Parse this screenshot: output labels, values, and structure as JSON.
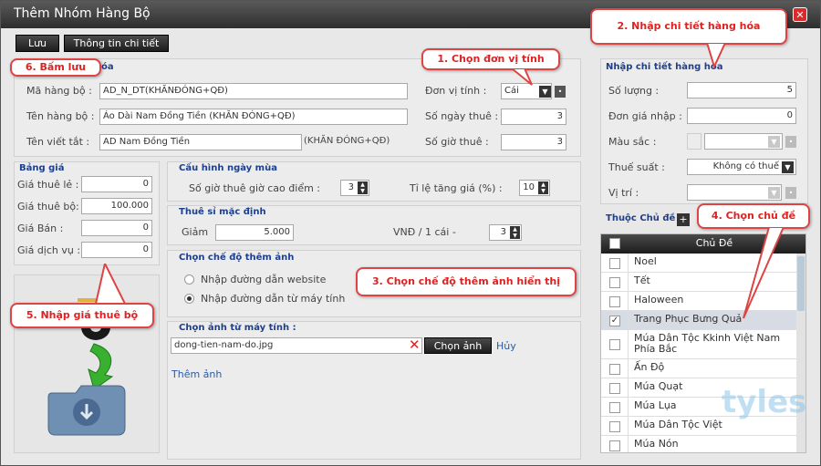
{
  "window": {
    "title": "Thêm Nhóm Hàng Bộ",
    "close": "✕"
  },
  "toolbar": {
    "save_label": "Lưu",
    "details_label": "Thông tin chi tiết"
  },
  "callouts": {
    "c1": "1. Chọn đơn vị tính",
    "c2": "2. Nhập chi tiết hàng hóa",
    "c3": "3. Chọn chế độ thêm ảnh hiển thị",
    "c4": "4. Chọn chủ đề",
    "c5": "5. Nhập giá thuê bộ",
    "c6": "6. Bấm lưu"
  },
  "info": {
    "title_tail": "óa",
    "code_label": "Mã hàng bộ :",
    "code_value": "AD_N_DT(KHĂNĐÓNG+QĐ)",
    "name_label": "Tên hàng bộ :",
    "name_value": "Áo Dài Nam Đồng Tiền (KHĂN ĐÓNG+QĐ)",
    "short_label": "Tên viết tắt :",
    "short_value": "AD Nam Đồng Tiền",
    "short_suffix": "(KHĂN ĐÓNG+QĐ)",
    "unit_label": "Đơn vị tính :",
    "unit_value": "Cái",
    "days_label": "Số ngày thuê :",
    "days_value": "3",
    "hours_label": "Số giờ thuê :",
    "hours_value": "3"
  },
  "pricing": {
    "title": "Bảng giá",
    "retail_label": "Giá thuê lẻ :",
    "retail_value": "0",
    "set_label": "Giá thuê bộ:",
    "set_value": "100.000",
    "sale_label": "Giá Bán :",
    "sale_value": "0",
    "service_label": "Giá dịch vụ :",
    "service_value": "0"
  },
  "holiday": {
    "title": "Cấu hình ngày mùa",
    "peak_label": "Số giờ thuê giờ cao điểm :",
    "peak_value": "3",
    "increase_label": "Tỉ lệ tăng giá (%) :",
    "increase_value": "10"
  },
  "default_rent": {
    "title": "Thuê sỉ mặc định",
    "discount_label": "Giảm",
    "discount_value": "5.000",
    "unit_text": "VNĐ / 1 cái -",
    "qty_value": "3"
  },
  "image_mode": {
    "title": "Chọn chế độ thêm ảnh",
    "opt_web": "Nhập đường dẫn website",
    "opt_local": "Nhập đường dẫn từ máy tính"
  },
  "image_pick": {
    "title": "Chọn ảnh từ máy tính :",
    "file_value": "dong-tien-nam-do.jpg",
    "choose_label": "Chọn ảnh",
    "cancel_label": "Hủy",
    "add_label": "Thêm ảnh"
  },
  "details": {
    "title": "Nhập chi tiết hàng hóa",
    "qty_label": "Số lượng :",
    "qty_value": "5",
    "cost_label": "Đơn giá nhập :",
    "cost_value": "0",
    "color_label": "Màu sắc :",
    "tax_label": "Thuế suất :",
    "tax_value": "Không có thuế",
    "location_label": "Vị trí :"
  },
  "topics": {
    "title": "Thuộc Chủ đề",
    "add": "+",
    "header": "Chủ Đề",
    "items": [
      {
        "label": "Noel",
        "checked": false
      },
      {
        "label": "Tết",
        "checked": false
      },
      {
        "label": "Haloween",
        "checked": false
      },
      {
        "label": "Trang Phục Bưng Quả",
        "checked": true
      },
      {
        "label": "Múa Dân Tộc Kkinh Việt Nam Phía Bắc",
        "checked": false
      },
      {
        "label": "Ấn Độ",
        "checked": false
      },
      {
        "label": "Múa Quạt",
        "checked": false
      },
      {
        "label": "Múa Lụa",
        "checked": false
      },
      {
        "label": "Múa Dân Tộc Việt",
        "checked": false
      },
      {
        "label": "Múa Nón",
        "checked": false
      }
    ]
  },
  "watermark": "tyles"
}
